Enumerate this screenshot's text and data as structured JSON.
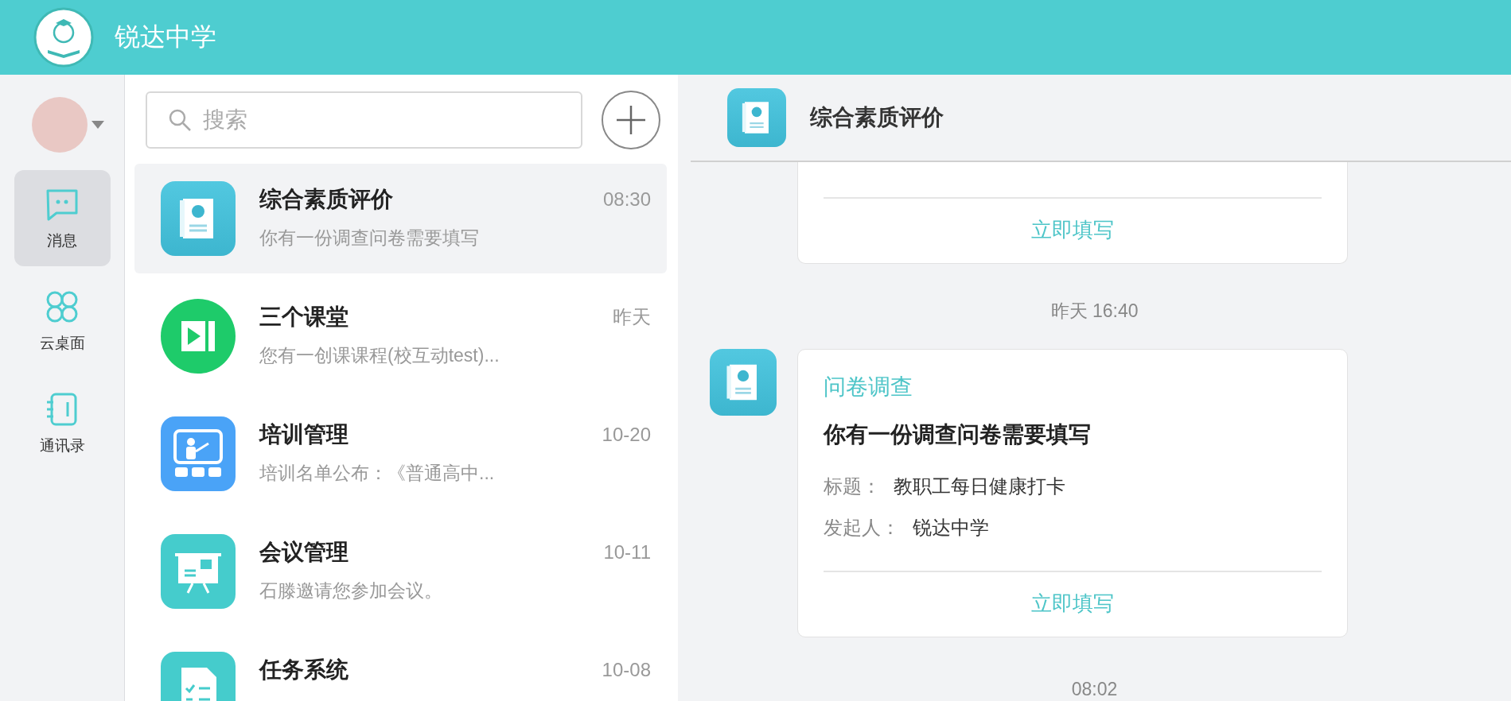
{
  "app": {
    "title": "锐达中学"
  },
  "nav": {
    "items": [
      {
        "label": "消息",
        "kind": "chat",
        "selected": true
      },
      {
        "label": "云桌面",
        "kind": "desktop",
        "selected": false
      },
      {
        "label": "通讯录",
        "kind": "contacts",
        "selected": false
      }
    ]
  },
  "search": {
    "placeholder": "搜索"
  },
  "conversations": [
    {
      "name": "综合素质评价",
      "preview": "你有一份调查问卷需要填写",
      "time": "08:30",
      "kind": "survey",
      "selected": true
    },
    {
      "name": "三个课堂",
      "preview": "您有一创课课程(校互动test)...",
      "time": "昨天",
      "kind": "classroom",
      "selected": false
    },
    {
      "name": "培训管理",
      "preview": "培训名单公布：《普通高中...",
      "time": "10-20",
      "kind": "training",
      "selected": false
    },
    {
      "name": "会议管理",
      "preview": "石滕邀请您参加会议。",
      "time": "10-11",
      "kind": "meeting",
      "selected": false
    },
    {
      "name": "任务系统",
      "time": "10-08",
      "kind": "task",
      "selected": false
    }
  ],
  "chat": {
    "title": "综合素质评价",
    "messages": [
      {
        "kind": "card-tail",
        "action": "立即填写"
      },
      {
        "kind": "time",
        "text": "昨天 16:40"
      },
      {
        "kind": "card",
        "category": "问卷调查",
        "heading": "你有一份调查问卷需要填写",
        "fields": [
          {
            "label": "标题：",
            "value": "教职工每日健康打卡"
          },
          {
            "label": "发起人：",
            "value": "锐达中学"
          }
        ],
        "action": "立即填写"
      },
      {
        "kind": "time",
        "text": "08:02"
      }
    ]
  }
}
